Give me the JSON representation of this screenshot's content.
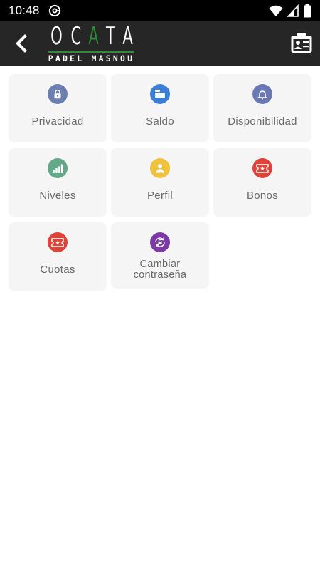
{
  "status_bar": {
    "time": "10:48",
    "notification_icon": "at-sign-icon",
    "wifi_icon": "wifi-icon",
    "signal_icon": "cell-signal-icon",
    "battery_icon": "battery-icon"
  },
  "app_bar": {
    "back_icon": "chevron-left-icon",
    "logo_title": [
      "O",
      "C",
      "A",
      "T",
      "A"
    ],
    "logo_subtitle": "PADEL MASNOU",
    "profile_icon": "id-card-icon"
  },
  "colors": {
    "app_bar": "#262626",
    "card_bg": "#f5f5f5",
    "label": "#6a6a6a",
    "logo_accent": "#2e8b3a"
  },
  "menu": {
    "items": [
      {
        "label": "Privacidad",
        "icon": "lock-icon",
        "color": "#6b7fb0"
      },
      {
        "label": "Saldo",
        "icon": "coins-icon",
        "color": "#3a7fd5"
      },
      {
        "label": "Disponibilidad",
        "icon": "bell-icon",
        "color": "#6b78b6"
      },
      {
        "label": "Niveles",
        "icon": "signal-bars-icon",
        "color": "#64a88a"
      },
      {
        "label": "Perfil",
        "icon": "person-icon",
        "color": "#f0c240"
      },
      {
        "label": "Bonos",
        "icon": "ticket-icon",
        "color": "#e04338"
      },
      {
        "label": "Cuotas",
        "icon": "ticket-icon",
        "color": "#e04338"
      },
      {
        "label": "Cambiar contraseña",
        "label_lines": [
          "Cambiar",
          "contraseña"
        ],
        "icon": "lock-refresh-icon",
        "color": "#7b3aa6"
      }
    ]
  }
}
